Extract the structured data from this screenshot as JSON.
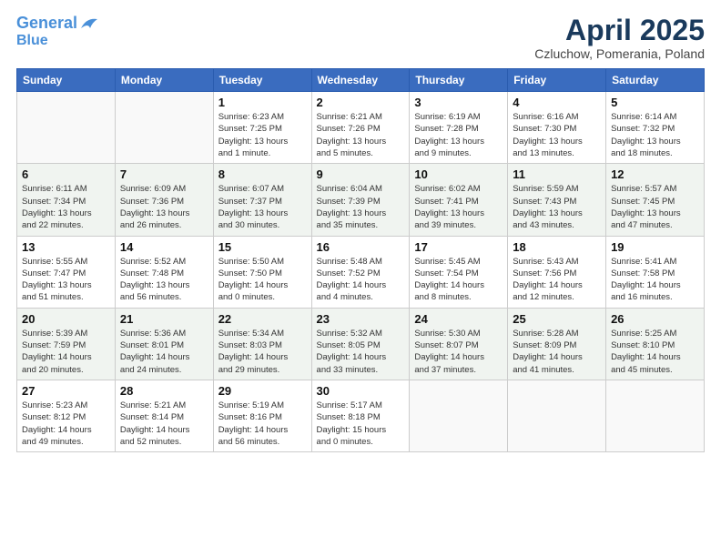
{
  "header": {
    "logo_line1": "General",
    "logo_line2": "Blue",
    "title": "April 2025",
    "subtitle": "Czluchow, Pomerania, Poland"
  },
  "calendar": {
    "headers": [
      "Sunday",
      "Monday",
      "Tuesday",
      "Wednesday",
      "Thursday",
      "Friday",
      "Saturday"
    ],
    "rows": [
      [
        {
          "day": "",
          "info": ""
        },
        {
          "day": "",
          "info": ""
        },
        {
          "day": "1",
          "info": "Sunrise: 6:23 AM\nSunset: 7:25 PM\nDaylight: 13 hours\nand 1 minute."
        },
        {
          "day": "2",
          "info": "Sunrise: 6:21 AM\nSunset: 7:26 PM\nDaylight: 13 hours\nand 5 minutes."
        },
        {
          "day": "3",
          "info": "Sunrise: 6:19 AM\nSunset: 7:28 PM\nDaylight: 13 hours\nand 9 minutes."
        },
        {
          "day": "4",
          "info": "Sunrise: 6:16 AM\nSunset: 7:30 PM\nDaylight: 13 hours\nand 13 minutes."
        },
        {
          "day": "5",
          "info": "Sunrise: 6:14 AM\nSunset: 7:32 PM\nDaylight: 13 hours\nand 18 minutes."
        }
      ],
      [
        {
          "day": "6",
          "info": "Sunrise: 6:11 AM\nSunset: 7:34 PM\nDaylight: 13 hours\nand 22 minutes."
        },
        {
          "day": "7",
          "info": "Sunrise: 6:09 AM\nSunset: 7:36 PM\nDaylight: 13 hours\nand 26 minutes."
        },
        {
          "day": "8",
          "info": "Sunrise: 6:07 AM\nSunset: 7:37 PM\nDaylight: 13 hours\nand 30 minutes."
        },
        {
          "day": "9",
          "info": "Sunrise: 6:04 AM\nSunset: 7:39 PM\nDaylight: 13 hours\nand 35 minutes."
        },
        {
          "day": "10",
          "info": "Sunrise: 6:02 AM\nSunset: 7:41 PM\nDaylight: 13 hours\nand 39 minutes."
        },
        {
          "day": "11",
          "info": "Sunrise: 5:59 AM\nSunset: 7:43 PM\nDaylight: 13 hours\nand 43 minutes."
        },
        {
          "day": "12",
          "info": "Sunrise: 5:57 AM\nSunset: 7:45 PM\nDaylight: 13 hours\nand 47 minutes."
        }
      ],
      [
        {
          "day": "13",
          "info": "Sunrise: 5:55 AM\nSunset: 7:47 PM\nDaylight: 13 hours\nand 51 minutes."
        },
        {
          "day": "14",
          "info": "Sunrise: 5:52 AM\nSunset: 7:48 PM\nDaylight: 13 hours\nand 56 minutes."
        },
        {
          "day": "15",
          "info": "Sunrise: 5:50 AM\nSunset: 7:50 PM\nDaylight: 14 hours\nand 0 minutes."
        },
        {
          "day": "16",
          "info": "Sunrise: 5:48 AM\nSunset: 7:52 PM\nDaylight: 14 hours\nand 4 minutes."
        },
        {
          "day": "17",
          "info": "Sunrise: 5:45 AM\nSunset: 7:54 PM\nDaylight: 14 hours\nand 8 minutes."
        },
        {
          "day": "18",
          "info": "Sunrise: 5:43 AM\nSunset: 7:56 PM\nDaylight: 14 hours\nand 12 minutes."
        },
        {
          "day": "19",
          "info": "Sunrise: 5:41 AM\nSunset: 7:58 PM\nDaylight: 14 hours\nand 16 minutes."
        }
      ],
      [
        {
          "day": "20",
          "info": "Sunrise: 5:39 AM\nSunset: 7:59 PM\nDaylight: 14 hours\nand 20 minutes."
        },
        {
          "day": "21",
          "info": "Sunrise: 5:36 AM\nSunset: 8:01 PM\nDaylight: 14 hours\nand 24 minutes."
        },
        {
          "day": "22",
          "info": "Sunrise: 5:34 AM\nSunset: 8:03 PM\nDaylight: 14 hours\nand 29 minutes."
        },
        {
          "day": "23",
          "info": "Sunrise: 5:32 AM\nSunset: 8:05 PM\nDaylight: 14 hours\nand 33 minutes."
        },
        {
          "day": "24",
          "info": "Sunrise: 5:30 AM\nSunset: 8:07 PM\nDaylight: 14 hours\nand 37 minutes."
        },
        {
          "day": "25",
          "info": "Sunrise: 5:28 AM\nSunset: 8:09 PM\nDaylight: 14 hours\nand 41 minutes."
        },
        {
          "day": "26",
          "info": "Sunrise: 5:25 AM\nSunset: 8:10 PM\nDaylight: 14 hours\nand 45 minutes."
        }
      ],
      [
        {
          "day": "27",
          "info": "Sunrise: 5:23 AM\nSunset: 8:12 PM\nDaylight: 14 hours\nand 49 minutes."
        },
        {
          "day": "28",
          "info": "Sunrise: 5:21 AM\nSunset: 8:14 PM\nDaylight: 14 hours\nand 52 minutes."
        },
        {
          "day": "29",
          "info": "Sunrise: 5:19 AM\nSunset: 8:16 PM\nDaylight: 14 hours\nand 56 minutes."
        },
        {
          "day": "30",
          "info": "Sunrise: 5:17 AM\nSunset: 8:18 PM\nDaylight: 15 hours\nand 0 minutes."
        },
        {
          "day": "",
          "info": ""
        },
        {
          "day": "",
          "info": ""
        },
        {
          "day": "",
          "info": ""
        }
      ]
    ]
  }
}
